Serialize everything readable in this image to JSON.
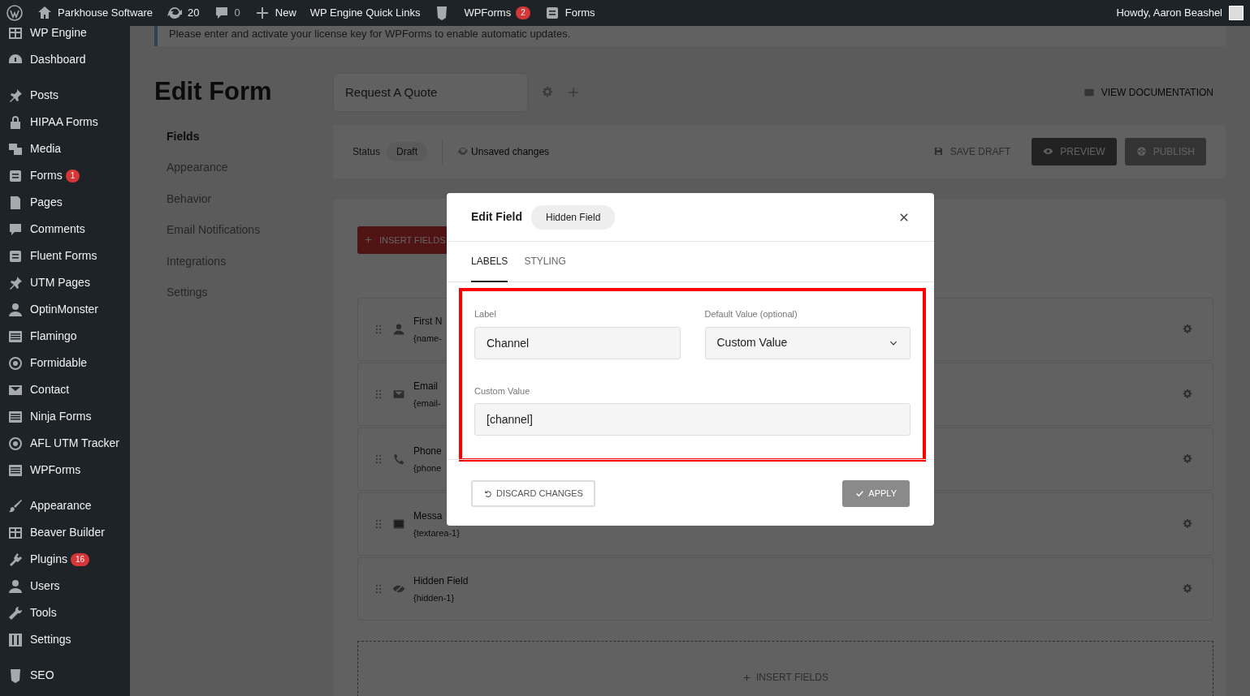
{
  "admin_bar": {
    "site": "Parkhouse Software",
    "updates": "20",
    "comments": "0",
    "new": "New",
    "quick_links": "WP Engine Quick Links",
    "wpforms": "WPForms",
    "wpforms_badge": "2",
    "forms": "Forms",
    "greeting": "Howdy, Aaron Beashel"
  },
  "sidebar": {
    "groups": [
      [
        {
          "label": "WP Engine"
        },
        {
          "label": "Dashboard"
        }
      ],
      [
        {
          "label": "Posts"
        },
        {
          "label": "HIPAA Forms"
        },
        {
          "label": "Media"
        },
        {
          "label": "Forms",
          "badge": "1"
        },
        {
          "label": "Pages"
        },
        {
          "label": "Comments"
        },
        {
          "label": "Fluent Forms"
        },
        {
          "label": "UTM Pages"
        },
        {
          "label": "OptinMonster"
        },
        {
          "label": "Flamingo"
        },
        {
          "label": "Formidable"
        },
        {
          "label": "Contact"
        },
        {
          "label": "Ninja Forms"
        },
        {
          "label": "AFL UTM Tracker"
        },
        {
          "label": "WPForms"
        }
      ],
      [
        {
          "label": "Appearance"
        },
        {
          "label": "Beaver Builder"
        },
        {
          "label": "Plugins",
          "badge": "16"
        },
        {
          "label": "Users"
        },
        {
          "label": "Tools"
        },
        {
          "label": "Settings"
        }
      ],
      [
        {
          "label": "SEO"
        }
      ]
    ]
  },
  "notice": {
    "before": "Please ",
    "link": "enter and activate",
    "after": " your license key for WPForms to enable automatic updates."
  },
  "page": {
    "title": "Edit Form",
    "form_name": "Request A Quote",
    "doc_link": "VIEW DOCUMENTATION"
  },
  "builder_nav": [
    {
      "label": "Fields",
      "selected": true
    },
    {
      "label": "Appearance",
      "selected": false
    },
    {
      "label": "Behavior",
      "selected": false
    },
    {
      "label": "Email Notifications",
      "selected": false
    },
    {
      "label": "Integrations",
      "selected": false
    },
    {
      "label": "Settings",
      "selected": false
    }
  ],
  "status_bar": {
    "status_label": "Status",
    "status": "Draft",
    "changes": "Unsaved changes",
    "save": "SAVE DRAFT",
    "preview": "PREVIEW",
    "publish": "PUBLISH"
  },
  "insert_button": "INSERT FIELDS",
  "fields": [
    {
      "kind": "person",
      "name": "First N",
      "tag": "{name-"
    },
    {
      "kind": "email",
      "name": "Email",
      "tag": "{email-"
    },
    {
      "kind": "phone",
      "name": "Phone",
      "tag": "{phone"
    },
    {
      "kind": "text",
      "name": "Messa",
      "tag": "{textarea-1}"
    },
    {
      "kind": "hidden",
      "name": "Hidden Field",
      "tag": "{hidden-1}"
    }
  ],
  "dropzone": "INSERT FIELDS",
  "modal": {
    "title": "Edit Field",
    "badge": "Hidden Field",
    "tabs": [
      {
        "label": "LABELS",
        "selected": true
      },
      {
        "label": "STYLING",
        "selected": false
      }
    ],
    "highlighted": true,
    "label_field": {
      "label": "Label",
      "value": "Channel"
    },
    "default_field": {
      "label": "Default Value (optional)",
      "value": "Custom Value"
    },
    "custom_field": {
      "label": "Custom Value",
      "value": "[channel]"
    },
    "discard": "DISCARD CHANGES",
    "apply": "APPLY"
  }
}
